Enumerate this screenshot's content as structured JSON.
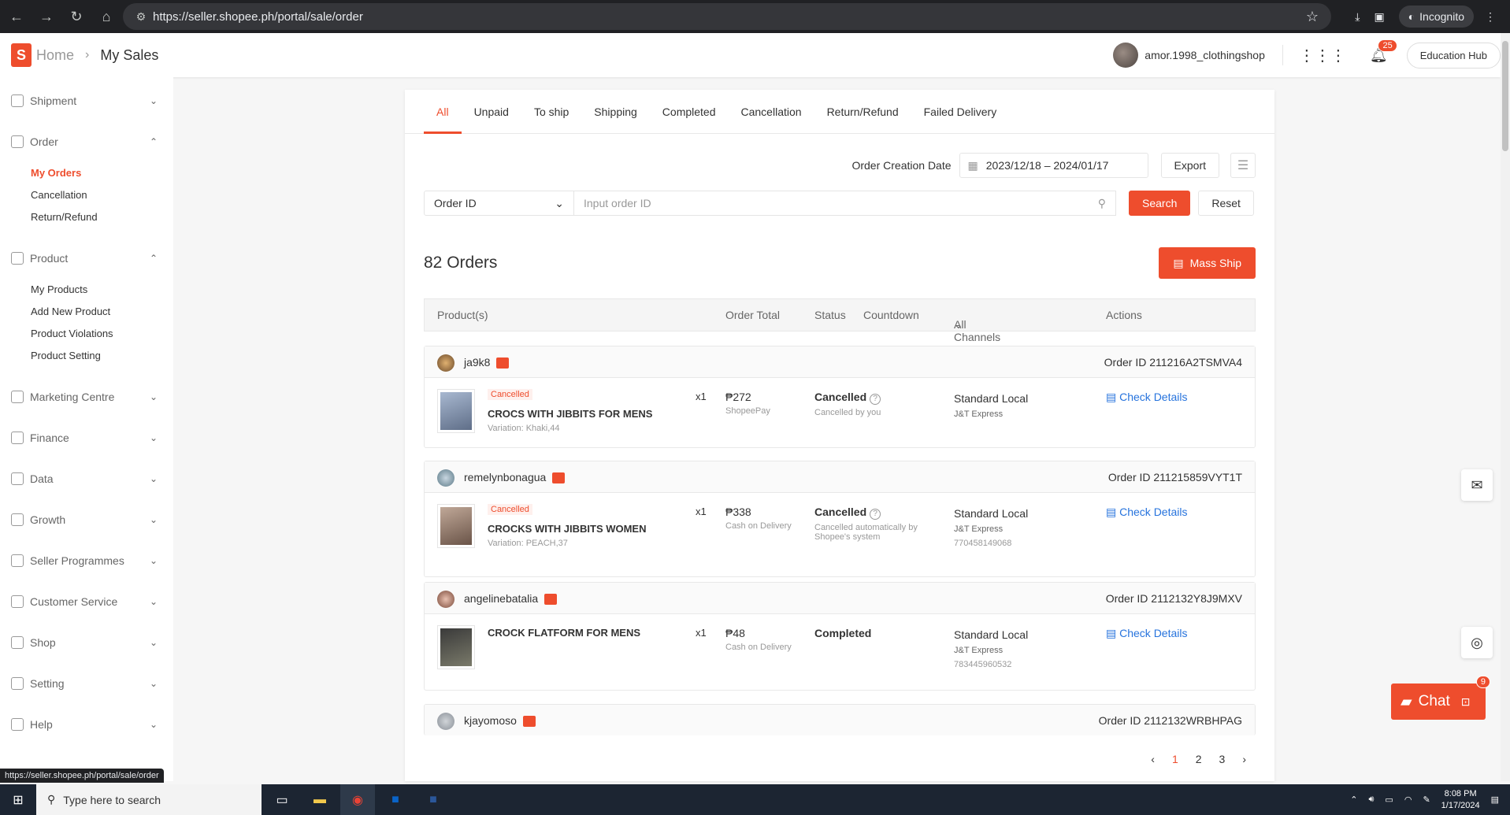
{
  "browser": {
    "url": "https://seller.shopee.ph/portal/sale/order",
    "mode": "Incognito"
  },
  "header": {
    "home": "Home",
    "page": "My Sales",
    "shop": "amor.1998_clothingshop",
    "notif_count": "25",
    "edu": "Education Hub"
  },
  "sidebar": {
    "shipment": "Shipment",
    "order": "Order",
    "order_items": [
      "My Orders",
      "Cancellation",
      "Return/Refund"
    ],
    "product": "Product",
    "product_items": [
      "My Products",
      "Add New Product",
      "Product Violations",
      "Product Setting"
    ],
    "marketing": "Marketing Centre",
    "finance": "Finance",
    "data": "Data",
    "growth": "Growth",
    "seller_prog": "Seller Programmes",
    "customer_service": "Customer Service",
    "shop": "Shop",
    "setting": "Setting",
    "help": "Help"
  },
  "tabs": [
    "All",
    "Unpaid",
    "To ship",
    "Shipping",
    "Completed",
    "Cancellation",
    "Return/Refund",
    "Failed Delivery"
  ],
  "filters": {
    "date_label": "Order Creation Date",
    "date_range": "2023/12/18 – 2024/01/17",
    "export": "Export",
    "select": "Order ID",
    "placeholder": "Input order ID",
    "search": "Search",
    "reset": "Reset"
  },
  "orders_count": "82 Orders",
  "mass_ship": "Mass Ship",
  "columns": {
    "product": "Product(s)",
    "total": "Order Total",
    "status": "Status",
    "countdown": "Countdown",
    "channels": "All Channels",
    "actions": "Actions"
  },
  "orders": [
    {
      "user": "ja9k8",
      "order_id": "Order ID 211216A2TSMVA4",
      "tag": "Cancelled",
      "product": "CROCS WITH JIBBITS FOR MENS",
      "variation": "Variation: Khaki,44",
      "qty": "x1",
      "total": "₱272",
      "payment": "ShopeePay",
      "status": "Cancelled",
      "status_sub": "Cancelled by you",
      "channel": "Standard Local",
      "carrier": "J&T Express",
      "tracking": "",
      "action": "Check Details"
    },
    {
      "user": "remelynbonagua",
      "order_id": "Order ID 211215859VYT1T",
      "tag": "Cancelled",
      "product": "CROCKS WITH JIBBITS WOMEN",
      "variation": "Variation: PEACH,37",
      "qty": "x1",
      "total": "₱338",
      "payment": "Cash on Delivery",
      "status": "Cancelled",
      "status_sub": "Cancelled automatically by Shopee's system",
      "channel": "Standard Local",
      "carrier": "J&T Express",
      "tracking": "770458149068",
      "action": "Check Details"
    },
    {
      "user": "angelinebatalia",
      "order_id": "Order ID 2112132Y8J9MXV",
      "tag": "",
      "product": "CROCK FLATFORM FOR MENS",
      "variation": "",
      "qty": "x1",
      "total": "₱48",
      "payment": "Cash on Delivery",
      "status": "Completed",
      "status_sub": "",
      "channel": "Standard Local",
      "carrier": "J&T Express",
      "tracking": "783445960532",
      "action": "Check Details"
    },
    {
      "user": "kjayomoso",
      "order_id": "Order ID 2112132WRBHPAG"
    }
  ],
  "pagination": [
    "1",
    "2",
    "3"
  ],
  "chat": {
    "label": "Chat",
    "badge": "9"
  },
  "status_url": "https://seller.shopee.ph/portal/sale/order",
  "taskbar": {
    "search": "Type here to search",
    "time": "8:08 PM",
    "date": "1/17/2024"
  }
}
